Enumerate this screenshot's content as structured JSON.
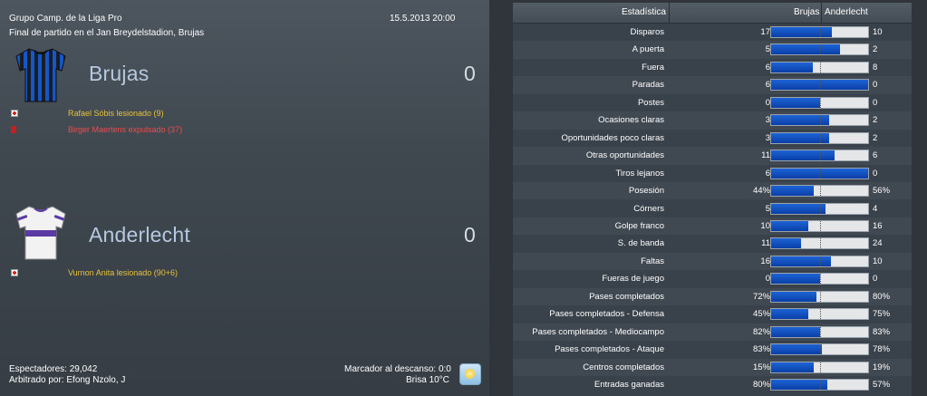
{
  "match": {
    "competition": "Grupo Camp. de la Liga Pro",
    "venue": "Final de partido en el Jan Breydelstadion, Brujas",
    "datetime": "15.5.2013 20:00"
  },
  "home": {
    "name": "Brujas",
    "score": "0",
    "events": [
      {
        "text": "Rafael Sóbis lesionado (9)",
        "icon": "injury-icon",
        "color": "#e8c33a"
      },
      {
        "text": "Birger Maertens expulsado (37)",
        "icon": "red-card-icon",
        "color": "#ef4b4b"
      }
    ]
  },
  "away": {
    "name": "Anderlecht",
    "score": "0",
    "events": [
      {
        "text": "Vurnon Anita lesionado (90+6)",
        "icon": "injury-icon",
        "color": "#e8c33a"
      }
    ]
  },
  "footer": {
    "attendance": "Espectadores: 29,042",
    "referee": "Arbitrado por: Efong Nzolo, J",
    "halftime": "Marcador al descanso: 0:0",
    "weather": "Brisa 10°C"
  },
  "stats_header": {
    "stat": "Estadística",
    "home": "Brujas",
    "away": "Anderlecht"
  },
  "stats": [
    {
      "label": "Disparos",
      "home": "17",
      "away": "10",
      "share": 0.63
    },
    {
      "label": "A puerta",
      "home": "5",
      "away": "2",
      "share": 0.71
    },
    {
      "label": "Fuera",
      "home": "6",
      "away": "8",
      "share": 0.43
    },
    {
      "label": "Paradas",
      "home": "6",
      "away": "0",
      "share": 1.0
    },
    {
      "label": "Postes",
      "home": "0",
      "away": "0",
      "share": 0.5
    },
    {
      "label": "Ocasiones claras",
      "home": "3",
      "away": "2",
      "share": 0.6
    },
    {
      "label": "Oportunidades poco claras",
      "home": "3",
      "away": "2",
      "share": 0.6
    },
    {
      "label": "Otras oportunidades",
      "home": "11",
      "away": "6",
      "share": 0.65
    },
    {
      "label": "Tiros lejanos",
      "home": "6",
      "away": "0",
      "share": 1.0
    },
    {
      "label": "Posesión",
      "home": "44%",
      "away": "56%",
      "share": 0.44
    },
    {
      "label": "Córners",
      "home": "5",
      "away": "4",
      "share": 0.56
    },
    {
      "label": "Golpe franco",
      "home": "10",
      "away": "16",
      "share": 0.38
    },
    {
      "label": "S. de banda",
      "home": "11",
      "away": "24",
      "share": 0.31
    },
    {
      "label": "Faltas",
      "home": "16",
      "away": "10",
      "share": 0.62
    },
    {
      "label": "Fueras de juego",
      "home": "0",
      "away": "0",
      "share": 0.5
    },
    {
      "label": "Pases completados",
      "home": "72%",
      "away": "80%",
      "share": 0.47
    },
    {
      "label": "Pases completados - Defensa",
      "home": "45%",
      "away": "75%",
      "share": 0.38
    },
    {
      "label": "Pases completados - Mediocampo",
      "home": "82%",
      "away": "83%",
      "share": 0.5
    },
    {
      "label": "Pases completados - Ataque",
      "home": "83%",
      "away": "78%",
      "share": 0.52
    },
    {
      "label": "Centros completados",
      "home": "15%",
      "away": "19%",
      "share": 0.44
    },
    {
      "label": "Entradas ganadas",
      "home": "80%",
      "away": "57%",
      "share": 0.58
    }
  ]
}
